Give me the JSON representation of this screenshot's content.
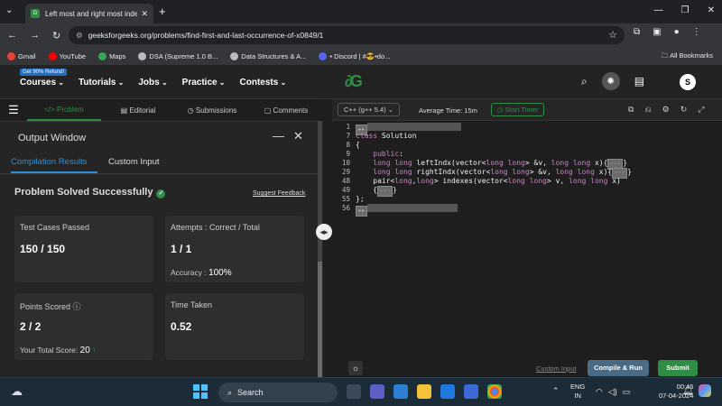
{
  "browser": {
    "tab_title": "Left most and right most index",
    "url": "geeksforgeeks.org/problems/find-first-and-last-occurrence-of-x0849/1",
    "bookmarks": [
      "Gmail",
      "YouTube",
      "Maps",
      "DSA (Supreme 1.0 B...",
      "Data Structures & A...",
      "• Discord | #😎•do..."
    ],
    "all_bookmarks": "All Bookmarks"
  },
  "gfg": {
    "refund_badge": "Get 90% Refund!",
    "menu": [
      "Courses",
      "Tutorials",
      "Jobs",
      "Practice",
      "Contests"
    ],
    "avatar_initial": "S"
  },
  "problem_tabs": [
    "Problem",
    "Editorial",
    "Submissions",
    "Comments"
  ],
  "output_window": {
    "title": "Output Window",
    "tabs": [
      "Compilation Results",
      "Custom Input"
    ],
    "status": "Problem Solved Successfully",
    "feedback_link": "Suggest Feedback",
    "cards": {
      "tests_label": "Test Cases Passed",
      "tests_value": "150 / 150",
      "attempts_label": "Attempts : Correct / Total",
      "attempts_value": "1 / 1",
      "accuracy_label": "Accuracy :",
      "accuracy_value": "100%",
      "points_label": "Points Scored",
      "points_value": "2 / 2",
      "total_score_label": "Your Total Score:",
      "total_score_value": "20",
      "time_label": "Time Taken",
      "time_value": "0.52"
    }
  },
  "editor": {
    "language": "C++ (g++ 5.4)",
    "avg_time": "Average Time: 15m",
    "timer": "Start Timer",
    "line_numbers": [
      "1",
      "7",
      "8",
      "9",
      "10",
      "29",
      "48",
      "49",
      "55",
      "56"
    ],
    "custom_input": "Custom Input",
    "compile_run": "Compile & Run",
    "submit": "Submit"
  },
  "taskbar": {
    "search": "Search",
    "lang_line1": "ENG",
    "lang_line2": "IN",
    "time": "00:46",
    "date": "07-04-2024"
  }
}
